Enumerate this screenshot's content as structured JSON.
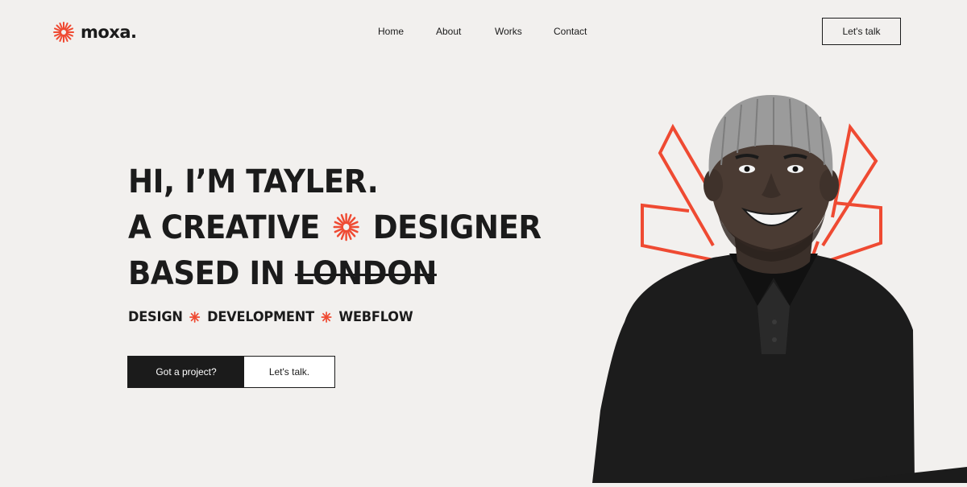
{
  "brand": {
    "name": "moxa.",
    "accent": "#ef4a32"
  },
  "nav": {
    "items": [
      "Home",
      "About",
      "Works",
      "Contact"
    ],
    "cta": "Let's talk"
  },
  "hero": {
    "line1": "HI, I’M TAYLER.",
    "line2_a": "A CREATIVE",
    "line2_b": "DESIGNER",
    "line3_a": "BASED IN",
    "line3_b": "LONDON",
    "services": [
      "DESIGN",
      "DEVELOPMENT",
      "WEBFLOW"
    ],
    "primary_button": "Got a project?",
    "secondary_button": "Let's talk."
  },
  "portrait": {
    "icon": "portrait-photo",
    "style": "black-and-white"
  }
}
